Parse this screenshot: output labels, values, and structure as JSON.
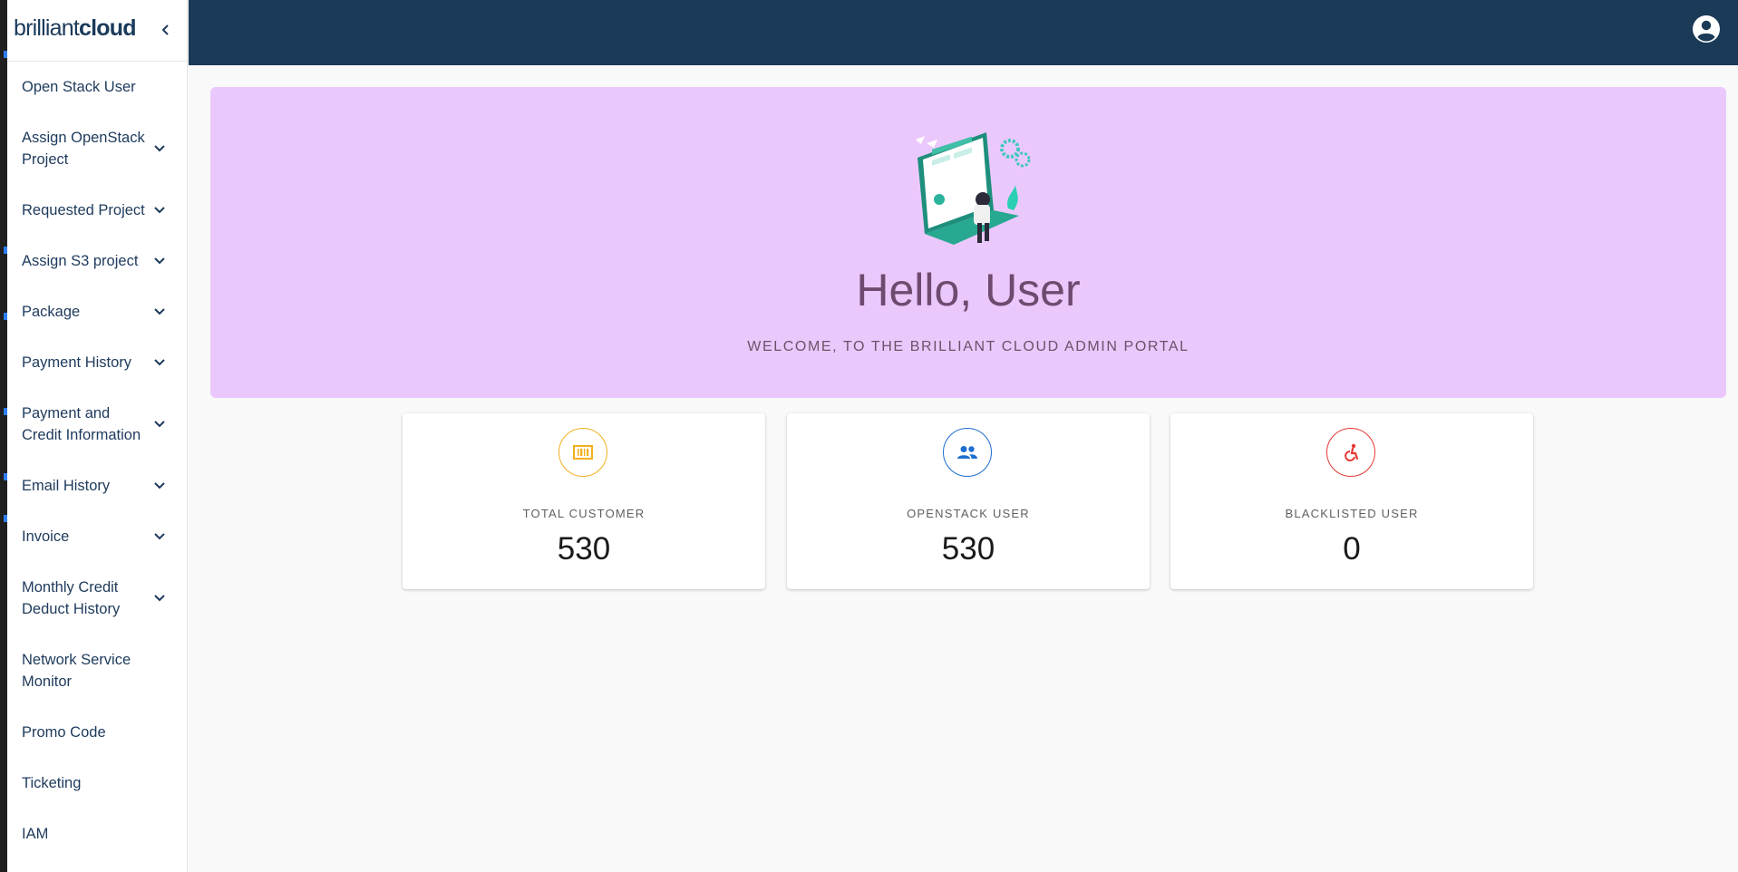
{
  "brand": {
    "logo_light": "brilliant",
    "logo_bold": "cloud"
  },
  "sidebar": {
    "items": [
      {
        "label": "Open Stack User",
        "expandable": false
      },
      {
        "label": "Assign OpenStack Project",
        "expandable": true
      },
      {
        "label": "Requested Project",
        "expandable": true
      },
      {
        "label": "Assign S3 project",
        "expandable": true
      },
      {
        "label": "Package",
        "expandable": true
      },
      {
        "label": "Payment History",
        "expandable": true
      },
      {
        "label": "Payment and Credit Information",
        "expandable": true
      },
      {
        "label": "Email History",
        "expandable": true
      },
      {
        "label": "Invoice",
        "expandable": true
      },
      {
        "label": "Monthly Credit Deduct History",
        "expandable": true
      },
      {
        "label": "Network Service Monitor",
        "expandable": false
      },
      {
        "label": "Promo Code",
        "expandable": false
      },
      {
        "label": "Ticketing",
        "expandable": false
      },
      {
        "label": "IAM",
        "expandable": false
      }
    ]
  },
  "hero": {
    "title": "Hello, User",
    "subtitle": "WELCOME, TO THE BRILLIANT CLOUD ADMIN PORTAL"
  },
  "stats": [
    {
      "label": "TOTAL CUSTOMER",
      "value": "530",
      "icon": "barcode-icon",
      "color": "#f2b01e"
    },
    {
      "label": "OPENSTACK USER",
      "value": "530",
      "icon": "people-icon",
      "color": "#1e6fd0"
    },
    {
      "label": "BLACKLISTED USER",
      "value": "0",
      "icon": "accessibility-icon",
      "color": "#e53935"
    }
  ],
  "colors": {
    "topbar": "#1b3a57",
    "hero_bg": "#ebc8fc",
    "nav_text": "#1e3a5c"
  }
}
